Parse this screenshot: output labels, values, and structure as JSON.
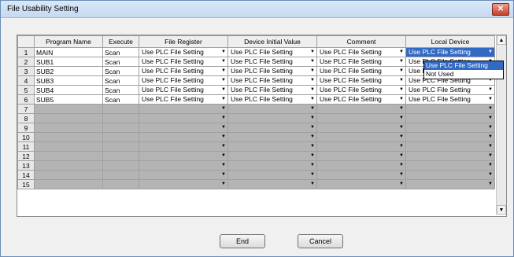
{
  "window": {
    "title": "File Usability Setting",
    "close_icon": "close-icon"
  },
  "columns": [
    "",
    "Program Name",
    "Execute",
    "File Register",
    "Device Initial Value",
    "Comment",
    "Local Device"
  ],
  "rows": [
    {
      "num": "1",
      "name": "MAIN",
      "exec": "Scan",
      "fr": "Use PLC File Setting",
      "div": "Use PLC File Setting",
      "cm": "Use PLC File Setting",
      "ld": "Use PLC File Setting"
    },
    {
      "num": "2",
      "name": "SUB1",
      "exec": "Scan",
      "fr": "Use PLC File Setting",
      "div": "Use PLC File Setting",
      "cm": "Use PLC File Setting",
      "ld": "Use PLC File Setting"
    },
    {
      "num": "3",
      "name": "SUB2",
      "exec": "Scan",
      "fr": "Use PLC File Setting",
      "div": "Use PLC File Setting",
      "cm": "Use PLC File Setting",
      "ld": "Use PLC File Setting"
    },
    {
      "num": "4",
      "name": "SUB3",
      "exec": "Scan",
      "fr": "Use PLC File Setting",
      "div": "Use PLC File Setting",
      "cm": "Use PLC File Setting",
      "ld": "Use PLC File Setting"
    },
    {
      "num": "5",
      "name": "SUB4",
      "exec": "Scan",
      "fr": "Use PLC File Setting",
      "div": "Use PLC File Setting",
      "cm": "Use PLC File Setting",
      "ld": "Use PLC File Setting"
    },
    {
      "num": "6",
      "name": "SUB5",
      "exec": "Scan",
      "fr": "Use PLC File Setting",
      "div": "Use PLC File Setting",
      "cm": "Use PLC File Setting",
      "ld": "Use PLC File Setting"
    }
  ],
  "empty_rows": [
    "7",
    "8",
    "9",
    "10",
    "11",
    "12",
    "13",
    "14",
    "15"
  ],
  "dropdown": {
    "options": [
      "Use PLC File Setting",
      "Not Used"
    ],
    "selected_index": 0
  },
  "buttons": {
    "end": "End",
    "cancel": "Cancel"
  }
}
